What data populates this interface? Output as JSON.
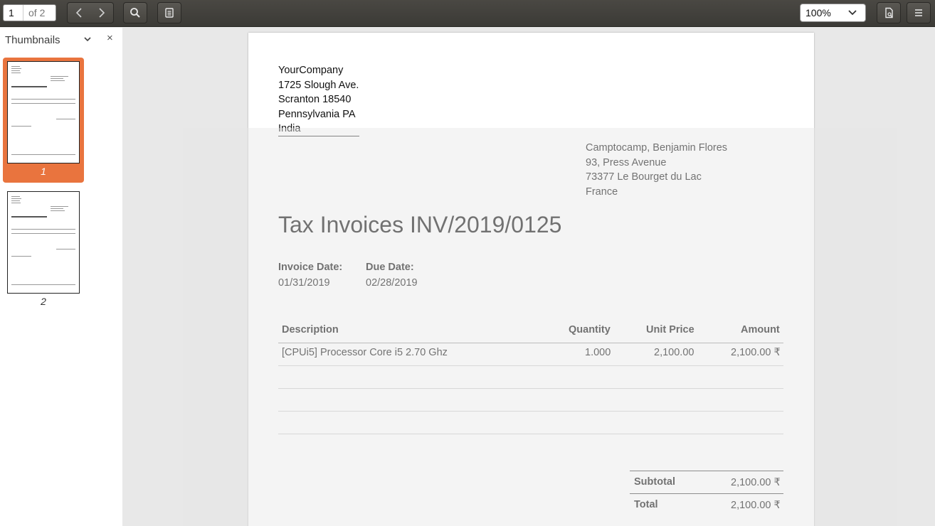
{
  "toolbar": {
    "page_current": "1",
    "page_of": "of 2",
    "zoom": "100%"
  },
  "sidebar": {
    "title": "Thumbnails",
    "thumbnails": [
      {
        "label": "1",
        "selected": true
      },
      {
        "label": "2",
        "selected": false
      }
    ]
  },
  "doc": {
    "company": [
      "YourCompany",
      "1725 Slough Ave.",
      "Scranton 18540",
      "Pennsylvania PA",
      "India"
    ],
    "customer": [
      "Camptocamp, Benjamin Flores",
      "93, Press Avenue",
      "73377 Le Bourget du Lac",
      "France"
    ],
    "title": "Tax Invoices INV/2019/0125",
    "invoice_date_label": "Invoice Date:",
    "invoice_date": "01/31/2019",
    "due_date_label": "Due Date:",
    "due_date": "02/28/2019",
    "table": {
      "headers": [
        "Description",
        "Quantity",
        "Unit Price",
        "Amount"
      ],
      "rows": [
        [
          "[CPUi5] Processor Core i5 2.70 Ghz",
          "1.000",
          "2,100.00",
          "2,100.00 ₹"
        ]
      ]
    },
    "subtotal_label": "Subtotal",
    "subtotal": "2,100.00 ₹",
    "total_label": "Total",
    "total": "2,100.00 ₹"
  },
  "colors": {
    "accent": "#e9743e",
    "toolbar": "#3b3a36"
  }
}
